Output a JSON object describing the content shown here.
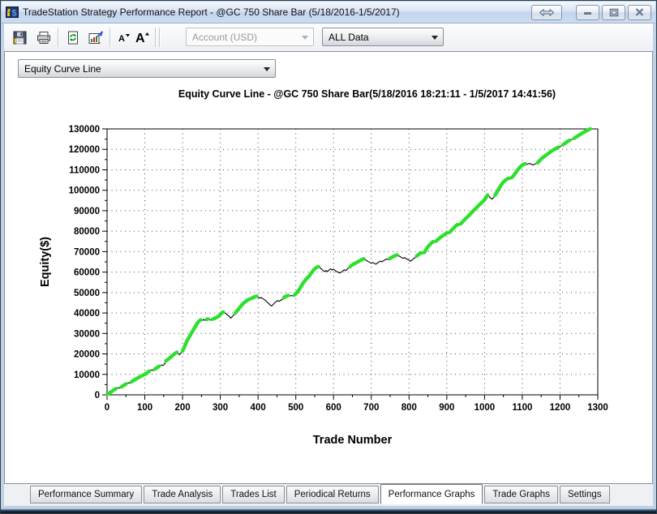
{
  "window": {
    "title": "TradeStation Strategy Performance Report - @GC 750 Share Bar (5/18/2016-1/5/2017)",
    "controls": [
      {
        "name": "resize-horizontal",
        "glyph": "double-arrow"
      },
      {
        "name": "minimize",
        "glyph": "minimize"
      },
      {
        "name": "restore",
        "glyph": "restore"
      },
      {
        "name": "close",
        "glyph": "close"
      }
    ]
  },
  "toolbar": {
    "buttons": [
      {
        "icon": "save-icon"
      },
      {
        "icon": "print-icon"
      },
      {
        "icon": "refresh-report-icon"
      },
      {
        "icon": "report-settings-icon"
      },
      {
        "icon": "decrease-font-icon"
      },
      {
        "icon": "increase-font-icon"
      }
    ],
    "account_combo": {
      "value": "Account (USD)",
      "disabled": true
    },
    "data_combo": {
      "value": "ALL Data",
      "disabled": false
    }
  },
  "graph_selector": {
    "value": "Equity Curve Line"
  },
  "chart_data": {
    "type": "line",
    "title": "Equity Curve Line - @GC 750 Share Bar(5/18/2016 18:21:11 - 1/5/2017 14:41:56)",
    "xlabel": "Trade Number",
    "ylabel": "Equity($)",
    "xlim": [
      0,
      1300
    ],
    "ylim": [
      0,
      130000
    ],
    "x_ticks": [
      0,
      100,
      200,
      300,
      400,
      500,
      600,
      700,
      800,
      900,
      1000,
      1100,
      1200,
      1300
    ],
    "y_ticks": [
      0,
      10000,
      20000,
      30000,
      40000,
      50000,
      60000,
      70000,
      80000,
      90000,
      100000,
      110000,
      120000,
      130000
    ],
    "grid": "dotted",
    "legend": "none",
    "line_color": "#000000",
    "new_high_color": "#2ce02c",
    "series_note": "points are [trade_number, equity, is_new_high_green]",
    "points": [
      [
        0,
        200,
        1
      ],
      [
        6,
        900,
        1
      ],
      [
        12,
        1600,
        1
      ],
      [
        18,
        2400,
        1
      ],
      [
        24,
        3100,
        1
      ],
      [
        30,
        3500,
        0
      ],
      [
        34,
        3300,
        0
      ],
      [
        38,
        3900,
        1
      ],
      [
        44,
        4600,
        1
      ],
      [
        50,
        5300,
        1
      ],
      [
        56,
        5900,
        0
      ],
      [
        60,
        5700,
        0
      ],
      [
        64,
        6300,
        1
      ],
      [
        70,
        7000,
        1
      ],
      [
        76,
        7700,
        1
      ],
      [
        82,
        8300,
        1
      ],
      [
        88,
        8900,
        1
      ],
      [
        94,
        9500,
        1
      ],
      [
        100,
        10000,
        1
      ],
      [
        106,
        10800,
        1
      ],
      [
        112,
        11600,
        1
      ],
      [
        118,
        12200,
        0
      ],
      [
        122,
        11900,
        0
      ],
      [
        126,
        12500,
        1
      ],
      [
        132,
        13200,
        1
      ],
      [
        138,
        14000,
        1
      ],
      [
        144,
        14600,
        0
      ],
      [
        148,
        14300,
        0
      ],
      [
        152,
        14900,
        0
      ],
      [
        156,
        16600,
        1
      ],
      [
        162,
        17400,
        1
      ],
      [
        168,
        18300,
        1
      ],
      [
        174,
        19300,
        1
      ],
      [
        180,
        20200,
        1
      ],
      [
        185,
        20800,
        1
      ],
      [
        188,
        20300,
        0
      ],
      [
        192,
        19600,
        0
      ],
      [
        196,
        20500,
        0
      ],
      [
        200,
        21500,
        1
      ],
      [
        204,
        23000,
        1
      ],
      [
        208,
        24800,
        1
      ],
      [
        212,
        26500,
        1
      ],
      [
        216,
        27800,
        1
      ],
      [
        220,
        29000,
        1
      ],
      [
        224,
        30300,
        1
      ],
      [
        228,
        31600,
        1
      ],
      [
        232,
        32900,
        1
      ],
      [
        236,
        34000,
        1
      ],
      [
        240,
        35300,
        1
      ],
      [
        244,
        36100,
        1
      ],
      [
        248,
        36700,
        1
      ],
      [
        252,
        36300,
        0
      ],
      [
        256,
        36800,
        0
      ],
      [
        260,
        36400,
        0
      ],
      [
        264,
        36900,
        1
      ],
      [
        268,
        37100,
        1
      ],
      [
        272,
        36700,
        0
      ],
      [
        276,
        36500,
        0
      ],
      [
        280,
        37000,
        1
      ],
      [
        284,
        37300,
        1
      ],
      [
        288,
        37700,
        1
      ],
      [
        292,
        38100,
        1
      ],
      [
        296,
        38500,
        1
      ],
      [
        300,
        39200,
        1
      ],
      [
        304,
        40000,
        1
      ],
      [
        308,
        40500,
        1
      ],
      [
        312,
        40100,
        0
      ],
      [
        316,
        39500,
        0
      ],
      [
        320,
        38900,
        0
      ],
      [
        324,
        38300,
        0
      ],
      [
        328,
        37500,
        0
      ],
      [
        332,
        38300,
        0
      ],
      [
        336,
        39100,
        0
      ],
      [
        340,
        40000,
        1
      ],
      [
        344,
        41000,
        1
      ],
      [
        348,
        41900,
        1
      ],
      [
        352,
        42800,
        1
      ],
      [
        356,
        43700,
        1
      ],
      [
        360,
        44500,
        1
      ],
      [
        364,
        45200,
        1
      ],
      [
        368,
        45800,
        1
      ],
      [
        372,
        46300,
        1
      ],
      [
        376,
        46700,
        1
      ],
      [
        380,
        47000,
        1
      ],
      [
        384,
        47300,
        1
      ],
      [
        388,
        47600,
        1
      ],
      [
        392,
        48000,
        1
      ],
      [
        396,
        48200,
        1
      ],
      [
        400,
        47800,
        0
      ],
      [
        404,
        47300,
        0
      ],
      [
        408,
        47600,
        0
      ],
      [
        412,
        47100,
        0
      ],
      [
        416,
        46600,
        0
      ],
      [
        420,
        46100,
        0
      ],
      [
        424,
        45400,
        0
      ],
      [
        428,
        44700,
        0
      ],
      [
        432,
        43900,
        0
      ],
      [
        436,
        43400,
        0
      ],
      [
        440,
        44200,
        0
      ],
      [
        444,
        45000,
        0
      ],
      [
        448,
        45600,
        0
      ],
      [
        452,
        46100,
        0
      ],
      [
        456,
        45700,
        0
      ],
      [
        460,
        46200,
        0
      ],
      [
        464,
        46600,
        0
      ],
      [
        468,
        47400,
        1
      ],
      [
        472,
        48000,
        1
      ],
      [
        476,
        48400,
        1
      ],
      [
        480,
        48600,
        1
      ],
      [
        484,
        48300,
        0
      ],
      [
        488,
        48500,
        0
      ],
      [
        492,
        48400,
        0
      ],
      [
        496,
        48700,
        1
      ],
      [
        500,
        49400,
        1
      ],
      [
        504,
        50200,
        1
      ],
      [
        508,
        51200,
        1
      ],
      [
        512,
        52400,
        1
      ],
      [
        516,
        53600,
        1
      ],
      [
        520,
        54800,
        1
      ],
      [
        524,
        55800,
        1
      ],
      [
        528,
        56700,
        1
      ],
      [
        532,
        57400,
        1
      ],
      [
        536,
        58200,
        1
      ],
      [
        540,
        59200,
        1
      ],
      [
        544,
        60300,
        1
      ],
      [
        548,
        61200,
        1
      ],
      [
        552,
        61900,
        1
      ],
      [
        556,
        62400,
        1
      ],
      [
        560,
        62700,
        1
      ],
      [
        564,
        62200,
        0
      ],
      [
        568,
        61500,
        0
      ],
      [
        572,
        60800,
        0
      ],
      [
        576,
        60300,
        0
      ],
      [
        580,
        60800,
        0
      ],
      [
        584,
        60200,
        0
      ],
      [
        588,
        61000,
        0
      ],
      [
        592,
        61600,
        0
      ],
      [
        596,
        61000,
        0
      ],
      [
        600,
        61400,
        0
      ],
      [
        604,
        60800,
        0
      ],
      [
        608,
        60300,
        0
      ],
      [
        612,
        59900,
        0
      ],
      [
        616,
        59600,
        0
      ],
      [
        620,
        59900,
        0
      ],
      [
        624,
        60500,
        0
      ],
      [
        628,
        61100,
        0
      ],
      [
        632,
        60700,
        0
      ],
      [
        636,
        61400,
        0
      ],
      [
        640,
        62000,
        0
      ],
      [
        644,
        62700,
        1
      ],
      [
        648,
        63300,
        1
      ],
      [
        652,
        63800,
        1
      ],
      [
        656,
        64200,
        1
      ],
      [
        660,
        64600,
        1
      ],
      [
        664,
        65000,
        1
      ],
      [
        668,
        65400,
        1
      ],
      [
        672,
        65800,
        1
      ],
      [
        676,
        66200,
        1
      ],
      [
        680,
        66500,
        1
      ],
      [
        684,
        66100,
        0
      ],
      [
        688,
        65600,
        0
      ],
      [
        692,
        65100,
        0
      ],
      [
        696,
        64700,
        0
      ],
      [
        700,
        64300,
        0
      ],
      [
        704,
        64700,
        0
      ],
      [
        708,
        64300,
        0
      ],
      [
        712,
        63900,
        0
      ],
      [
        716,
        64400,
        0
      ],
      [
        720,
        64900,
        0
      ],
      [
        724,
        65400,
        0
      ],
      [
        728,
        65000,
        0
      ],
      [
        732,
        65500,
        0
      ],
      [
        736,
        66000,
        0
      ],
      [
        740,
        66400,
        0
      ],
      [
        744,
        66100,
        0
      ],
      [
        748,
        66500,
        1
      ],
      [
        752,
        67000,
        1
      ],
      [
        756,
        67400,
        1
      ],
      [
        760,
        67800,
        1
      ],
      [
        764,
        68100,
        1
      ],
      [
        768,
        68400,
        1
      ],
      [
        772,
        68000,
        0
      ],
      [
        776,
        67600,
        0
      ],
      [
        780,
        67100,
        0
      ],
      [
        784,
        66700,
        0
      ],
      [
        788,
        67100,
        0
      ],
      [
        792,
        66600,
        0
      ],
      [
        796,
        66200,
        0
      ],
      [
        800,
        65800,
        0
      ],
      [
        804,
        65300,
        0
      ],
      [
        808,
        65900,
        0
      ],
      [
        812,
        66500,
        0
      ],
      [
        816,
        67100,
        0
      ],
      [
        820,
        67800,
        1
      ],
      [
        824,
        68400,
        1
      ],
      [
        828,
        69000,
        1
      ],
      [
        832,
        69400,
        1
      ],
      [
        836,
        69000,
        0
      ],
      [
        840,
        69500,
        1
      ],
      [
        844,
        70600,
        1
      ],
      [
        848,
        71800,
        1
      ],
      [
        852,
        72800,
        1
      ],
      [
        856,
        73600,
        1
      ],
      [
        860,
        74300,
        1
      ],
      [
        864,
        74900,
        1
      ],
      [
        868,
        74500,
        0
      ],
      [
        872,
        75200,
        1
      ],
      [
        876,
        75900,
        1
      ],
      [
        880,
        76500,
        1
      ],
      [
        884,
        77100,
        1
      ],
      [
        888,
        77600,
        1
      ],
      [
        892,
        78100,
        1
      ],
      [
        896,
        78600,
        1
      ],
      [
        900,
        79200,
        1
      ],
      [
        904,
        78800,
        0
      ],
      [
        908,
        79500,
        1
      ],
      [
        912,
        80300,
        1
      ],
      [
        916,
        81100,
        1
      ],
      [
        920,
        81900,
        1
      ],
      [
        924,
        82600,
        1
      ],
      [
        928,
        83200,
        1
      ],
      [
        932,
        82800,
        0
      ],
      [
        936,
        83500,
        1
      ],
      [
        940,
        84200,
        1
      ],
      [
        944,
        85000,
        1
      ],
      [
        948,
        85800,
        1
      ],
      [
        952,
        86500,
        1
      ],
      [
        956,
        87200,
        1
      ],
      [
        960,
        87900,
        1
      ],
      [
        964,
        88700,
        1
      ],
      [
        968,
        89500,
        1
      ],
      [
        972,
        90300,
        1
      ],
      [
        976,
        91000,
        1
      ],
      [
        980,
        91700,
        1
      ],
      [
        984,
        92500,
        1
      ],
      [
        988,
        93200,
        1
      ],
      [
        992,
        93900,
        1
      ],
      [
        996,
        94600,
        1
      ],
      [
        1000,
        95400,
        1
      ],
      [
        1004,
        96400,
        1
      ],
      [
        1008,
        97600,
        1
      ],
      [
        1012,
        97000,
        0
      ],
      [
        1016,
        96200,
        0
      ],
      [
        1020,
        95700,
        0
      ],
      [
        1024,
        96500,
        0
      ],
      [
        1028,
        97600,
        1
      ],
      [
        1032,
        98800,
        1
      ],
      [
        1036,
        100100,
        1
      ],
      [
        1040,
        101400,
        1
      ],
      [
        1044,
        102600,
        1
      ],
      [
        1048,
        103600,
        1
      ],
      [
        1052,
        104400,
        1
      ],
      [
        1056,
        105000,
        1
      ],
      [
        1060,
        105500,
        1
      ],
      [
        1064,
        105900,
        1
      ],
      [
        1068,
        105500,
        0
      ],
      [
        1072,
        106200,
        1
      ],
      [
        1076,
        107000,
        1
      ],
      [
        1080,
        108000,
        1
      ],
      [
        1084,
        109000,
        1
      ],
      [
        1088,
        110000,
        1
      ],
      [
        1092,
        110900,
        1
      ],
      [
        1096,
        111700,
        1
      ],
      [
        1100,
        112300,
        1
      ],
      [
        1104,
        112700,
        1
      ],
      [
        1108,
        113000,
        1
      ],
      [
        1112,
        112600,
        0
      ],
      [
        1116,
        112900,
        0
      ],
      [
        1120,
        113100,
        0
      ],
      [
        1124,
        112700,
        0
      ],
      [
        1128,
        112400,
        0
      ],
      [
        1132,
        112700,
        0
      ],
      [
        1136,
        113000,
        0
      ],
      [
        1140,
        113400,
        1
      ],
      [
        1144,
        114100,
        1
      ],
      [
        1148,
        114900,
        1
      ],
      [
        1152,
        115600,
        1
      ],
      [
        1156,
        116200,
        1
      ],
      [
        1160,
        116800,
        1
      ],
      [
        1166,
        117600,
        1
      ],
      [
        1172,
        118400,
        1
      ],
      [
        1178,
        119200,
        1
      ],
      [
        1184,
        119900,
        1
      ],
      [
        1190,
        120500,
        1
      ],
      [
        1196,
        121100,
        1
      ],
      [
        1202,
        121600,
        0
      ],
      [
        1208,
        122300,
        1
      ],
      [
        1214,
        123100,
        1
      ],
      [
        1220,
        123900,
        1
      ],
      [
        1226,
        124500,
        1
      ],
      [
        1232,
        124900,
        0
      ],
      [
        1238,
        125500,
        1
      ],
      [
        1244,
        126200,
        1
      ],
      [
        1250,
        126900,
        1
      ],
      [
        1256,
        127600,
        1
      ],
      [
        1262,
        128300,
        1
      ],
      [
        1268,
        128900,
        1
      ],
      [
        1274,
        129500,
        1
      ],
      [
        1280,
        130000,
        1
      ]
    ]
  },
  "tabs": {
    "items": [
      "Performance Summary",
      "Trade Analysis",
      "Trades List",
      "Periodical Returns",
      "Performance Graphs",
      "Trade Graphs",
      "Settings"
    ],
    "active": "Performance Graphs"
  },
  "colors": {
    "titlebar_gradient_top": "#f4f8fc",
    "titlebar_gradient_bottom": "#cbdcf0",
    "frame": "#bfd2e8",
    "equity_green": "#2ce02c",
    "curve_black": "#000000",
    "plot_background": "#ffffff"
  }
}
